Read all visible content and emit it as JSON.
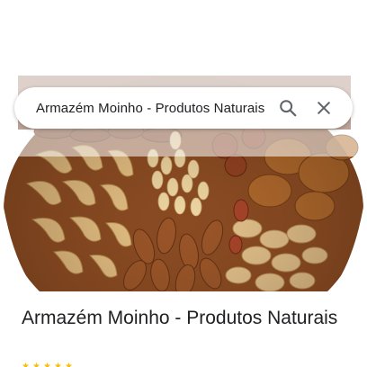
{
  "search": {
    "query": "Armazém Moinho - Produtos Naturais",
    "search_icon": "search-icon",
    "clear_icon": "close-icon"
  },
  "place": {
    "title": "Armazém Moinho - Produtos Naturais",
    "photo": "mixed-nuts-photo",
    "rating_icons": [
      "star-icon",
      "star-icon",
      "star-icon",
      "star-icon",
      "star-icon"
    ]
  },
  "colors": {
    "accent_star": "#fbbc04",
    "text": "#202124",
    "icon": "#5f6368"
  }
}
